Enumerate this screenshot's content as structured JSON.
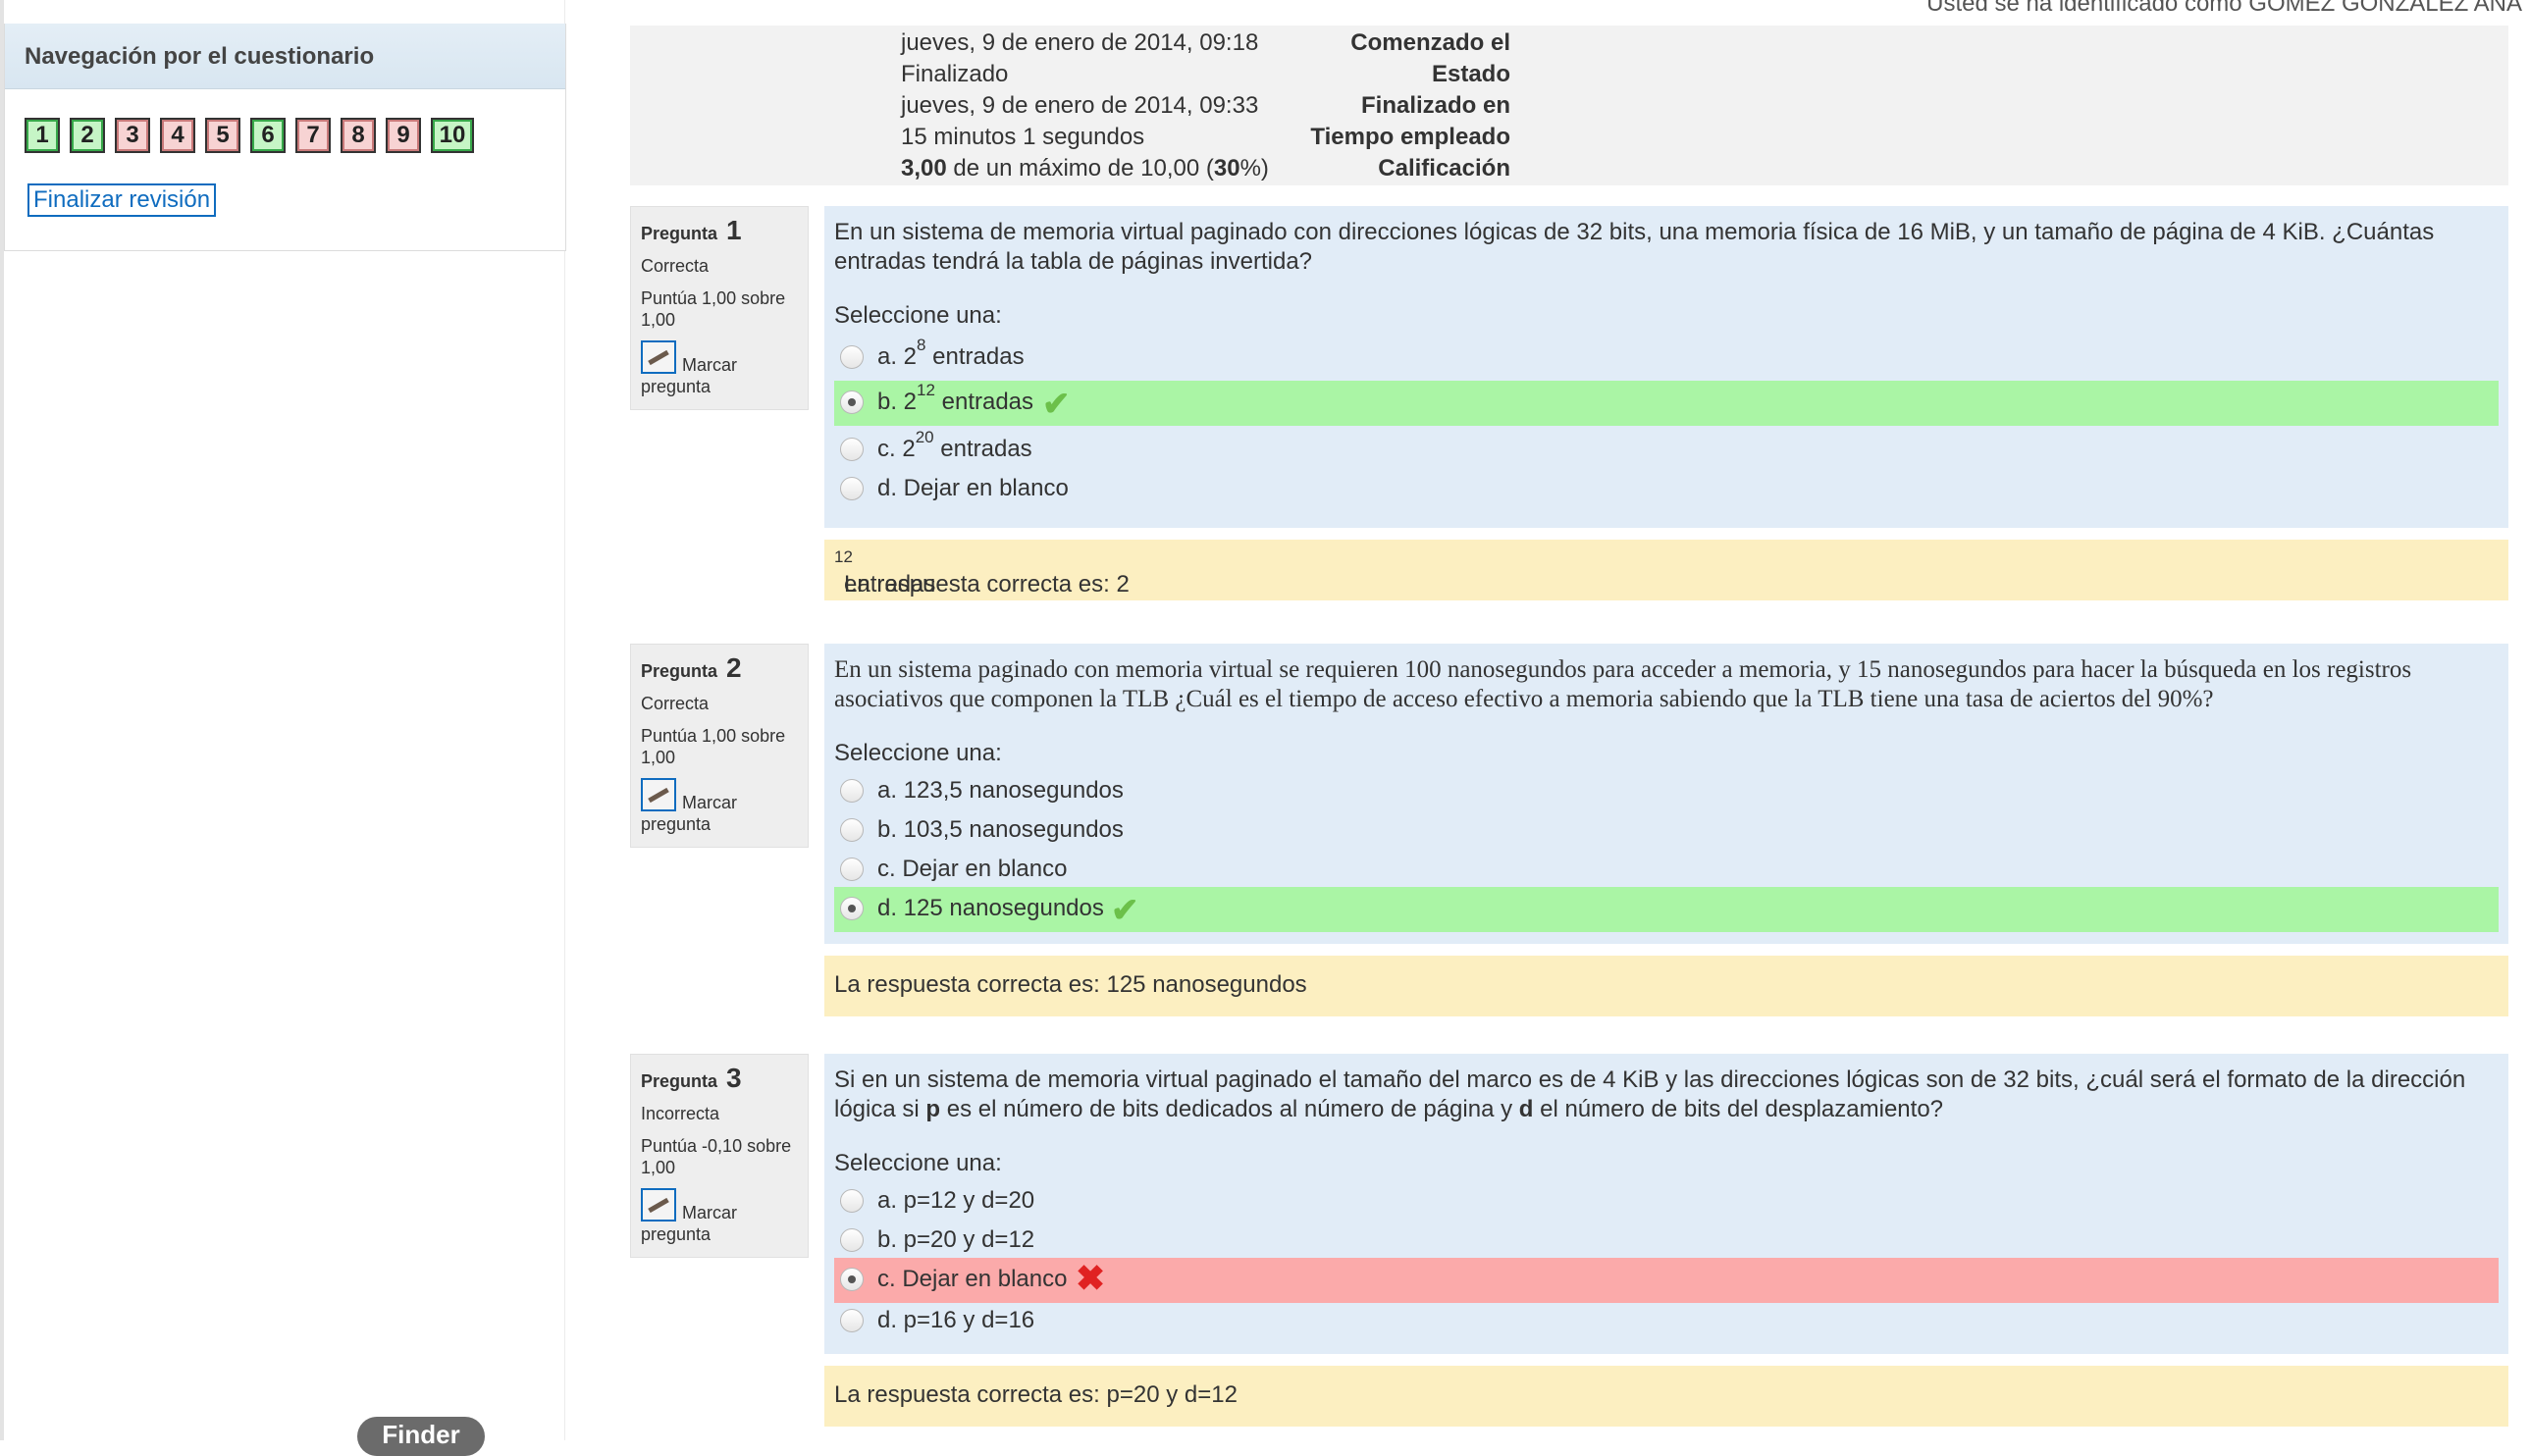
{
  "header": {
    "user_text": "Usted se ha identificado como GÓMEZ GONZÁLEZ ANA"
  },
  "nav": {
    "title": "Navegación por el cuestionario",
    "questions": [
      {
        "n": "1",
        "status": "correct"
      },
      {
        "n": "2",
        "status": "correct"
      },
      {
        "n": "3",
        "status": "incorrect"
      },
      {
        "n": "4",
        "status": "incorrect"
      },
      {
        "n": "5",
        "status": "incorrect"
      },
      {
        "n": "6",
        "status": "correct"
      },
      {
        "n": "7",
        "status": "incorrect"
      },
      {
        "n": "8",
        "status": "incorrect"
      },
      {
        "n": "9",
        "status": "incorrect"
      },
      {
        "n": "10",
        "status": "correct"
      }
    ],
    "finish_label": "Finalizar revisión"
  },
  "summary": [
    {
      "key": "Comenzado el",
      "value": "jueves, 9 de enero de 2014, 09:18"
    },
    {
      "key": "Estado",
      "value": "Finalizado"
    },
    {
      "key": "Finalizado en",
      "value": "jueves, 9 de enero de 2014, 09:33"
    },
    {
      "key": "Tiempo empleado",
      "value": "15 minutos 1 segundos"
    },
    {
      "key": "Calificación",
      "value_bold": "3,00",
      "value_mid": " de un máximo de 10,00 (",
      "value_pct": "30",
      "value_end": "%)"
    }
  ],
  "questions": [
    {
      "label": "Pregunta",
      "number": "1",
      "state": "Correcta",
      "grade": "Puntúa 1,00 sobre 1,00",
      "flag": "Marcar",
      "flag2": "pregunta",
      "text": "En un sistema de memoria virtual paginado con direcciones lógicas de 32 bits, una memoria física de 16 MiB, y un tamaño de página de 4 KiB. ¿Cuántas entradas tendrá la tabla de páginas invertida?",
      "select_label": "Seleccione una:",
      "options": [
        {
          "prefix": "a. 2",
          "sup": "8",
          "suffix": " entradas"
        },
        {
          "prefix": "b. 2",
          "sup": "12",
          "suffix": " entradas"
        },
        {
          "prefix": "c. 2",
          "sup": "20",
          "suffix": " entradas"
        },
        {
          "prefix": "d. Dejar en blanco",
          "sup": "",
          "suffix": ""
        }
      ],
      "answer_prefix": "La respuesta correcta es: 2",
      "answer_sup": "12",
      "answer_suffix": " entradas"
    },
    {
      "label": "Pregunta",
      "number": "2",
      "state": "Correcta",
      "grade": "Puntúa 1,00 sobre 1,00",
      "flag": "Marcar",
      "flag2": "pregunta",
      "text": "En un sistema paginado con memoria virtual se requieren 100 nanosegundos para acceder a memoria, y 15 nanosegundos para hacer la búsqueda en los registros asociativos que componen la TLB ¿Cuál es el tiempo de acceso efectivo a memoria sabiendo que la TLB tiene una tasa de aciertos del 90%?",
      "select_label": "Seleccione una:",
      "options": [
        {
          "text": "a. 123,5 nanosegundos"
        },
        {
          "text": "b. 103,5 nanosegundos"
        },
        {
          "text": "c. Dejar en blanco"
        },
        {
          "text": "d. 125 nanosegundos"
        }
      ],
      "answer": "La respuesta correcta es: 125 nanosegundos"
    },
    {
      "label": "Pregunta",
      "number": "3",
      "state": "Incorrecta",
      "grade": "Puntúa -0,10 sobre 1,00",
      "flag": "Marcar",
      "flag2": "pregunta",
      "text_a": "Si en un sistema de memoria virtual paginado el tamaño del marco es de 4 KiB y las direcciones lógicas son de 32 bits, ¿cuál será el formato de la dirección lógica si ",
      "text_p": "p",
      "text_b": " es el número de bits dedicados al número de página y ",
      "text_d": "d",
      "text_c": " el número de bits del desplazamiento?",
      "select_label": "Seleccione una:",
      "options": [
        {
          "text": "a. p=12 y d=20"
        },
        {
          "text": "b. p=20 y d=12"
        },
        {
          "text": "c. Dejar en blanco"
        },
        {
          "text": "d. p=16 y d=16"
        }
      ],
      "answer": "La respuesta correcta es: p=20 y d=12"
    }
  ],
  "dock": {
    "finder_label": "Finder"
  },
  "colors": {
    "correct_bg": "#aaf5a5",
    "incorrect_bg": "#fbaaaa",
    "answer_bg": "#fcefc1",
    "question_bg": "#e1ecf7",
    "link": "#0f6cbf"
  },
  "icons": {
    "correct": "check-icon",
    "incorrect": "cross-icon",
    "flag": "flag-icon"
  }
}
